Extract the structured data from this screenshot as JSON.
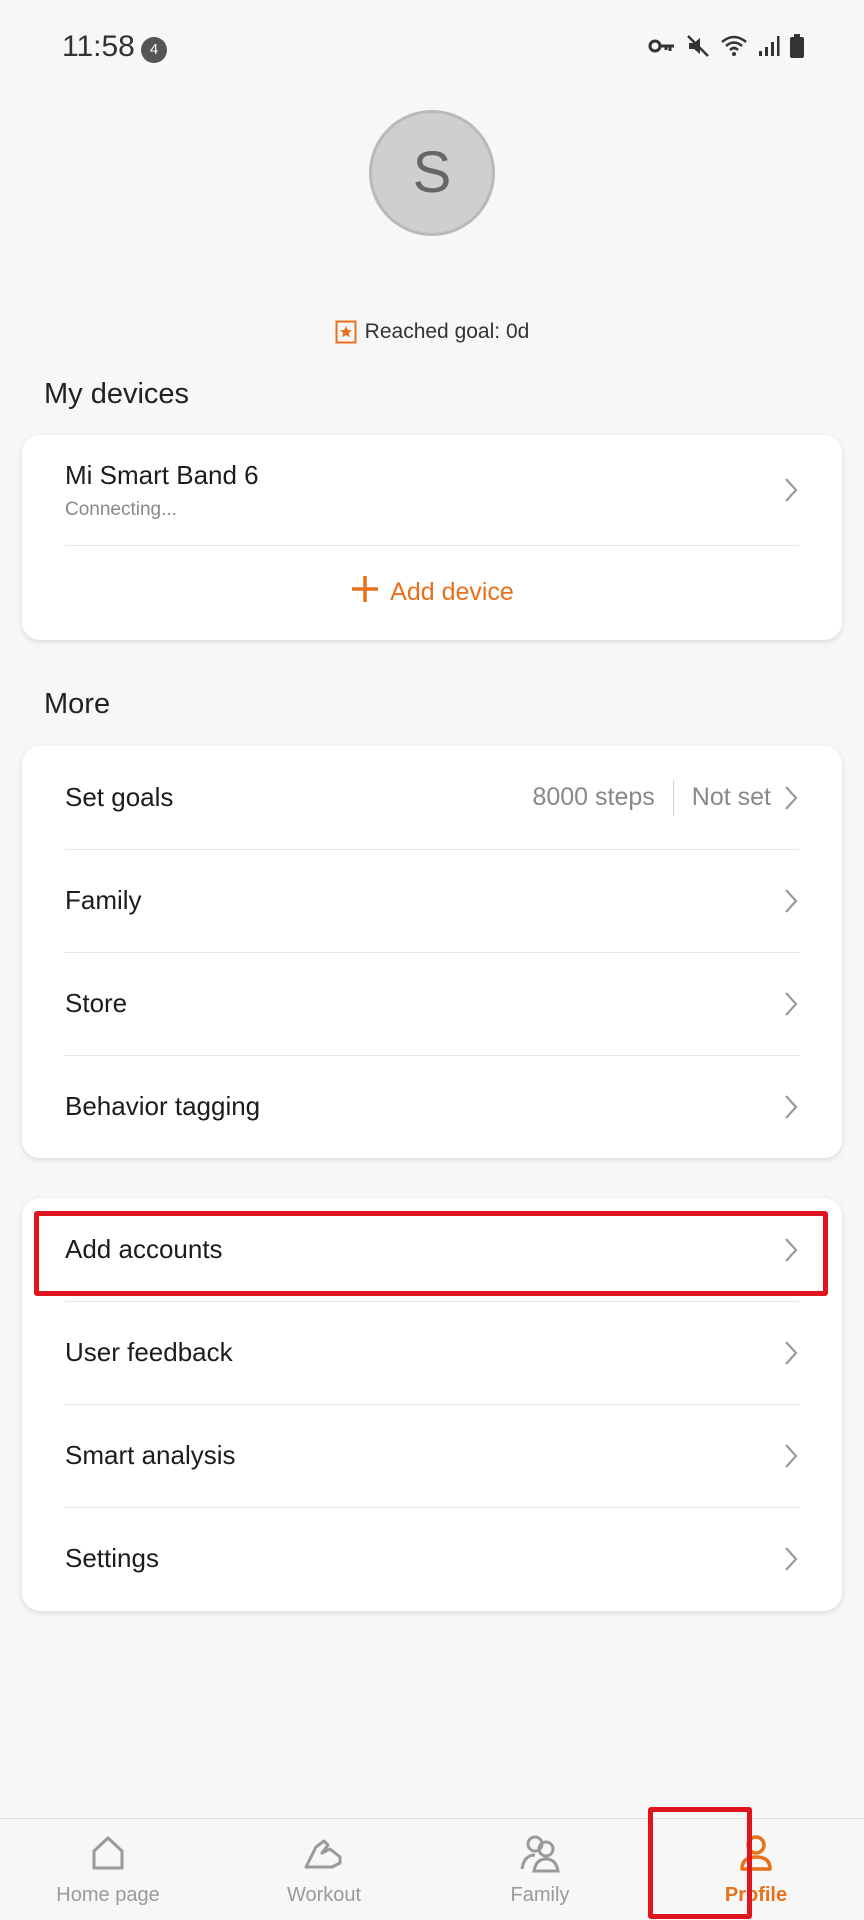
{
  "status_bar": {
    "time": "11:58",
    "notification_count": "4"
  },
  "profile": {
    "avatar_letter": "S",
    "goal_text": "Reached goal: 0d"
  },
  "devices": {
    "section_title": "My devices",
    "device_name": "Mi Smart Band 6",
    "device_status": "Connecting...",
    "add_device_label": "Add device"
  },
  "more": {
    "section_title": "More",
    "items": [
      {
        "label": "Set goals",
        "value": "8000 steps",
        "status": "Not set"
      },
      {
        "label": "Family"
      },
      {
        "label": "Store"
      },
      {
        "label": "Behavior tagging"
      }
    ]
  },
  "account_card": {
    "items": [
      {
        "label": "Add accounts"
      },
      {
        "label": "User feedback"
      },
      {
        "label": "Smart analysis"
      },
      {
        "label": "Settings"
      }
    ]
  },
  "bottom_nav": {
    "active": "Profile",
    "items": [
      {
        "label": "Home page",
        "icon": "home-icon"
      },
      {
        "label": "Workout",
        "icon": "shoe-icon"
      },
      {
        "label": "Family",
        "icon": "family-icon"
      },
      {
        "label": "Profile",
        "icon": "profile-icon"
      }
    ]
  },
  "colors": {
    "accent": "#e8701a",
    "highlight": "#e0141e",
    "background": "#f7f7f7"
  }
}
